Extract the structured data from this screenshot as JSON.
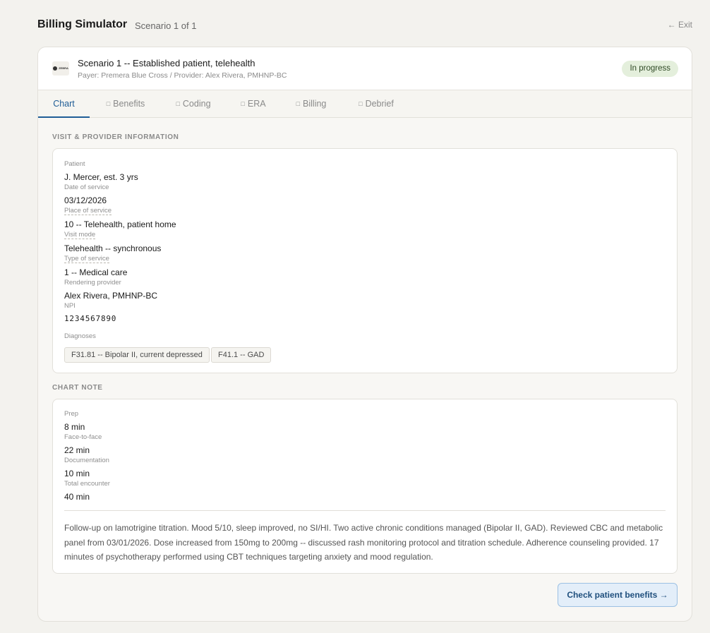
{
  "header": {
    "app_title": "Billing Simulator",
    "scenario_count": "Scenario 1 of 1",
    "exit_label": "← Exit"
  },
  "scenario": {
    "logo_text": "ZEBRA",
    "title": "Scenario 1 -- Established patient, telehealth",
    "meta": "Payer: Premera Blue Cross / Provider: Alex Rivera, PMHNP-BC",
    "status": "In progress",
    "status_color": "#e4efdc"
  },
  "tabs": [
    {
      "label": "Chart",
      "active": true
    },
    {
      "label": "Benefits",
      "active": false
    },
    {
      "label": "Coding",
      "active": false
    },
    {
      "label": "ERA",
      "active": false
    },
    {
      "label": "Billing",
      "active": false
    },
    {
      "label": "Debrief",
      "active": false
    }
  ],
  "tab_checkbox_glyph": "□",
  "visit": {
    "section_label": "VISIT & PROVIDER INFORMATION",
    "fields": [
      {
        "label": "Patient",
        "value": "J. Mercer, est. 3 yrs"
      },
      {
        "label": "Date of service",
        "value": "03/12/2026"
      },
      {
        "label": "Place of service",
        "value": "10 -- Telehealth, patient home"
      },
      {
        "label": "Visit mode",
        "value": "Telehealth -- synchronous"
      },
      {
        "label": "Type of service",
        "value": "1 -- Medical care"
      },
      {
        "label": "Rendering provider",
        "value": "Alex Rivera, PMHNP-BC"
      },
      {
        "label": "NPI",
        "value": "1234567890"
      }
    ],
    "diagnoses_label": "Diagnoses",
    "diagnoses": [
      "F31.81 -- Bipolar II, current depressed",
      "F41.1 -- GAD"
    ]
  },
  "chart_note": {
    "section_label": "CHART NOTE",
    "times": [
      {
        "label": "Prep",
        "value": "8 min"
      },
      {
        "label": "Face-to-face",
        "value": "22 min"
      },
      {
        "label": "Documentation",
        "value": "10 min"
      },
      {
        "label": "Total encounter",
        "value": "40 min"
      }
    ],
    "text": "Follow-up on lamotrigine titration. Mood 5/10, sleep improved, no SI/HI. Two active chronic conditions managed (Bipolar II, GAD). Reviewed CBC and metabolic panel from 03/01/2026. Dose increased from 150mg to 200mg -- discussed rash monitoring protocol and titration schedule. Adherence counseling provided. 17 minutes of psychotherapy performed using CBT techniques targeting anxiety and mood regulation."
  },
  "cta": {
    "label": "Check patient benefits →"
  },
  "colors": {
    "accent": "#1f5d96",
    "background": "#f3f2ee"
  }
}
